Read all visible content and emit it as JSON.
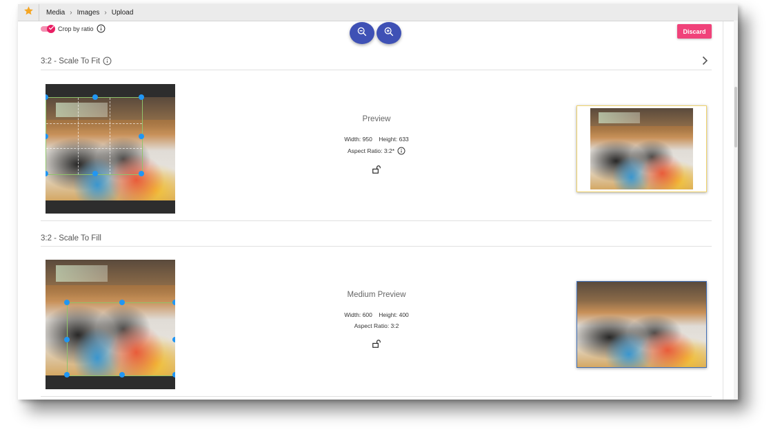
{
  "breadcrumb": {
    "items": [
      {
        "label": "Media"
      },
      {
        "label": "Images"
      },
      {
        "label": "Upload"
      }
    ]
  },
  "toolbar": {
    "crop_by_ratio_label": "Crop by ratio",
    "crop_by_ratio_on": true,
    "discard_label": "Discard",
    "accent_color": "#3f51b5",
    "discard_color": "#f0427a",
    "toggle_color": "#e91e63",
    "star_color": "#f5a623"
  },
  "sections": [
    {
      "title": "3:2 - Scale To Fit",
      "preview_title": "Preview",
      "width_label": "Width: 950",
      "height_label": "Height: 633",
      "aspect_label": "Aspect Ratio: 3:2*",
      "preview_border_color": "#f0d36a"
    },
    {
      "title": "3:2 - Scale To Fill",
      "preview_title": "Medium Preview",
      "width_label": "Width: 600",
      "height_label": "Height: 400",
      "aspect_label": "Aspect Ratio: 3:2",
      "preview_border_color": "#3f6db5"
    }
  ],
  "icons": [
    "star-icon",
    "chevron-right-icon",
    "info-icon",
    "zoom-out-icon",
    "zoom-in-icon",
    "check-icon",
    "unlock-icon"
  ]
}
